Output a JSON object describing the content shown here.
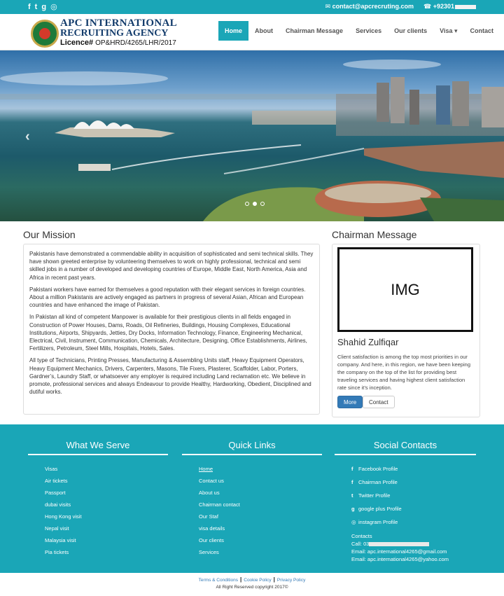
{
  "topbar": {
    "social_icons": [
      "facebook-icon",
      "twitter-icon",
      "google-plus-icon",
      "instagram-icon"
    ],
    "email": "contact@apcrecruting.com",
    "phone": "+92301",
    "accent_color": "#1aa6b7"
  },
  "brand": {
    "line1": "APC INTERNATIONAL",
    "line2": "RECRUITING AGENCY",
    "licence_label": "Licence#",
    "licence_no": "OP&HRD/4265/LHR/2017"
  },
  "nav": {
    "home": "Home",
    "about": "About",
    "chairman": "Chairman Message",
    "services": "Services",
    "clients": "Our clients",
    "visa": "Visa ▾",
    "contact": "Contact"
  },
  "hero": {
    "prev": "‹",
    "slide_count": 3,
    "active_slide": 1
  },
  "mission": {
    "title": "Our Mission",
    "p1": "Pakistanis have demonstrated a commendable ability in acquisition of sophisticated and semi technical skills. They have shown greeted enterprise by volunteering themselves to work on highly professional, technical and semi skilled jobs in a number of developed and developing countries of Europe, Middle East, North America, Asia and Africa in recent past years.",
    "p2": "Pakistani workers have earned for themselves a good reputation with their elegant services in foreign countries. About a million Pakistanis are actively engaged as partners in progress of several Asian, African and European countries and have enhanced the image of Pakistan.",
    "p3": "In Pakistan all kind of competent Manpower is available for their prestigious clients in all fields engaged in Construction of Power Houses, Dams, Roads, Oil Refineries, Buildings, Housing Complexes, Educational Institutions, Airports, Shipyards, Jetties, Dry Docks, Information Technology, Finance, Engineering Mechanical, Electrical, Civil, Instrument, Communication, Chemicals, Architecture, Designing, Office Establishments, Airlines, Fertilizers, Petroleum, Steel Mills, Hospitals, Hotels, Sales.",
    "p4": "All type of Technicians, Printing Presses, Manufacturing & Assembling Units staff, Heavy Equipment Operators, Heavy Equipment Mechanics, Drivers, Carpenters, Masons, Tile Fixers, Plasterer, Scaffolder, Labor, Porters, Gardner’s, Laundry Staff, or whatsoever any employer is required including Land reclamation etc. We believe in promote, professional services and always Endeavour to provide Healthy, Hardworking, Obedient, Disciplined and dutiful works."
  },
  "chairman": {
    "title": "Chairman Message",
    "img_placeholder": "IMG",
    "name": "Shahid Zulfiqar",
    "text": "Client satisfaction is among the top most priorities in our company. And here, in this region, we have been keeping the company on the top of the list for providing best traveling services and having highest client satisfaction rate since it’s inception.",
    "more": "More",
    "contact": "Contact"
  },
  "footer": {
    "serve_title": "What We Serve",
    "serve": [
      "Visas",
      "Air tickets",
      "Passport",
      "dubai visits",
      "Hong Kong visit",
      "Nepal visit",
      "Malaysia visit",
      "Pia tickets"
    ],
    "links_title": "Quick Links",
    "links": [
      "Home",
      "Contact us",
      "About us",
      "Chairman contact",
      "Our Staf",
      "visa details",
      "Our clients",
      "Services"
    ],
    "social_title": "Social Contacts",
    "social": [
      "Facebook Profile",
      "Chairman Profile",
      "Twitter Profile",
      "google plus Profile",
      "instagram Profile"
    ],
    "contacts_label": "Contacts",
    "call": "Call: 03",
    "email1": "Email: apc.international4265@gmail.com",
    "email2": "Email: apc.international4265@yahoo.com"
  },
  "bottom": {
    "terms": "Terms & Conditions",
    "cookie": "Cookie Policy",
    "privacy": "Privacy Policy",
    "copyright": "All Right Reserved copyright 2017©"
  }
}
